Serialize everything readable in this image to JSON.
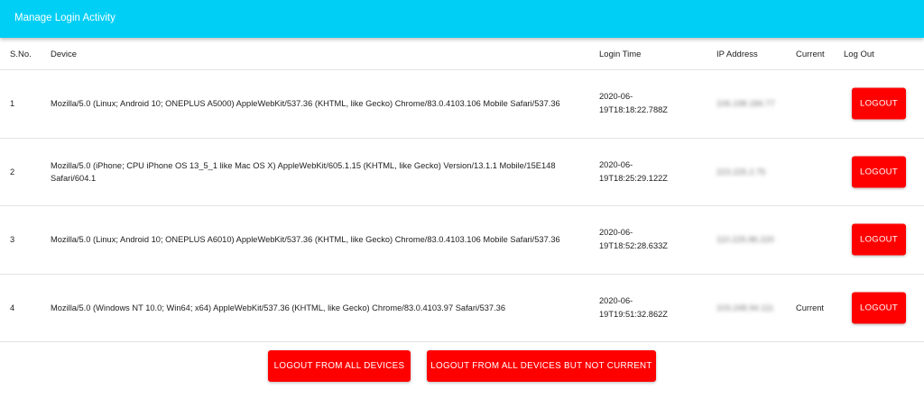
{
  "header": {
    "title": "Manage Login Activity",
    "color": "#00cff5"
  },
  "columns": {
    "sno": "S.No.",
    "device": "Device",
    "login_time": "Login Time",
    "ip": "IP Address",
    "current": "Current",
    "logout": "Log Out"
  },
  "rows": [
    {
      "sno": "1",
      "device": "Mozilla/5.0 (Linux; Android 10; ONEPLUS A5000) AppleWebKit/537.36 (KHTML, like Gecko) Chrome/83.0.4103.106 Mobile Safari/537.36",
      "time_line1": "2020-06-",
      "time_line2": "19T18:18:22.788Z",
      "ip": "106.198.184.77",
      "current": "",
      "logout_label": "LOGOUT"
    },
    {
      "sno": "2",
      "device": "Mozilla/5.0 (iPhone; CPU iPhone OS 13_5_1 like Mac OS X) AppleWebKit/605.1.15 (KHTML, like Gecko) Version/13.1.1 Mobile/15E148 Safari/604.1",
      "time_line1": "2020-06-",
      "time_line2": "19T18:25:29.122Z",
      "ip": "223.225.2.75",
      "current": "",
      "logout_label": "LOGOUT"
    },
    {
      "sno": "3",
      "device": "Mozilla/5.0 (Linux; Android 10; ONEPLUS A6010) AppleWebKit/537.36 (KHTML, like Gecko) Chrome/83.0.4103.106 Mobile Safari/537.36",
      "time_line1": "2020-06-",
      "time_line2": "19T18:52:28.633Z",
      "ip": "110.225.86.220",
      "current": "",
      "logout_label": "LOGOUT"
    },
    {
      "sno": "4",
      "device": "Mozilla/5.0 (Windows NT 10.0; Win64; x64) AppleWebKit/537.36 (KHTML, like Gecko) Chrome/83.0.4103.97 Safari/537.36",
      "time_line1": "2020-06-",
      "time_line2": "19T19:51:32.862Z",
      "ip": "103.248.94.111",
      "current": "Current",
      "logout_label": "LOGOUT"
    }
  ],
  "actions": {
    "logout_all": "LOGOUT FROM ALL DEVICES",
    "logout_all_but_current": "LOGOUT FROM ALL DEVICES BUT NOT CURRENT"
  },
  "colors": {
    "danger": "#ff0000"
  }
}
